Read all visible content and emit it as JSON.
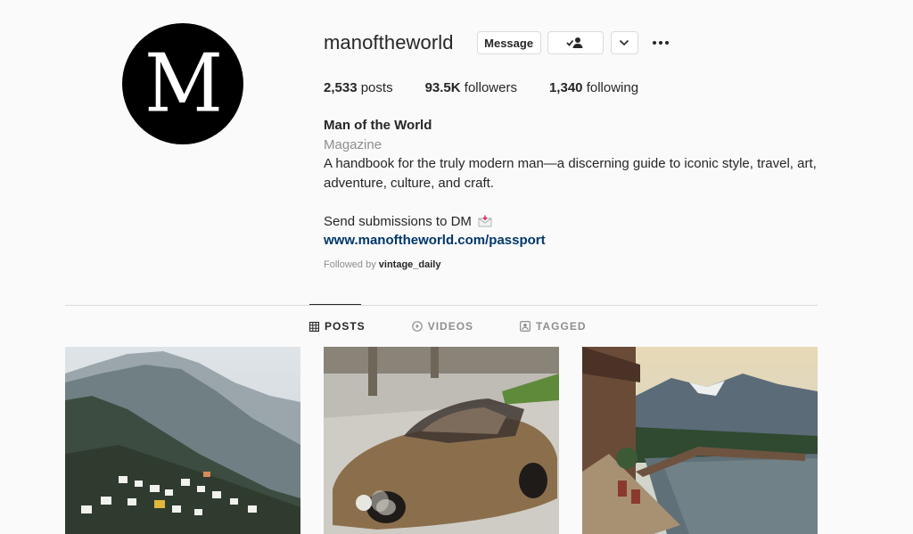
{
  "profile": {
    "avatar_letter": "M",
    "username": "manoftheworld",
    "message_label": "Message",
    "stats": [
      {
        "count": "2,533",
        "label": "posts"
      },
      {
        "count": "93.5K",
        "label": "followers"
      },
      {
        "count": "1,340",
        "label": "following"
      }
    ],
    "bio": {
      "name": "Man of the World",
      "category": "Magazine",
      "line1": "A handbook for the truly modern man—a discerning guide to iconic style, travel, art,",
      "line2": "adventure, culture, and craft.",
      "submissions": "Send submissions to DM",
      "link": "www.manoftheworld.com/passport",
      "followed_prefix": "Followed by",
      "followed_user": "vintage_daily"
    }
  },
  "tabs": [
    {
      "label": "POSTS",
      "icon": "grid-icon",
      "active": true
    },
    {
      "label": "VIDEOS",
      "icon": "play-circle-icon",
      "active": false
    },
    {
      "label": "TAGGED",
      "icon": "tag-icon",
      "active": false
    }
  ],
  "posts": [
    {
      "subject": "misty fjord village hillside"
    },
    {
      "subject": "brown vintage convertible sports car"
    },
    {
      "subject": "lakeside wooden cabins with mountains"
    }
  ],
  "colors": {
    "link": "#00376b",
    "muted": "#8e8e8e",
    "text": "#262626",
    "border": "#dbdbdb"
  }
}
